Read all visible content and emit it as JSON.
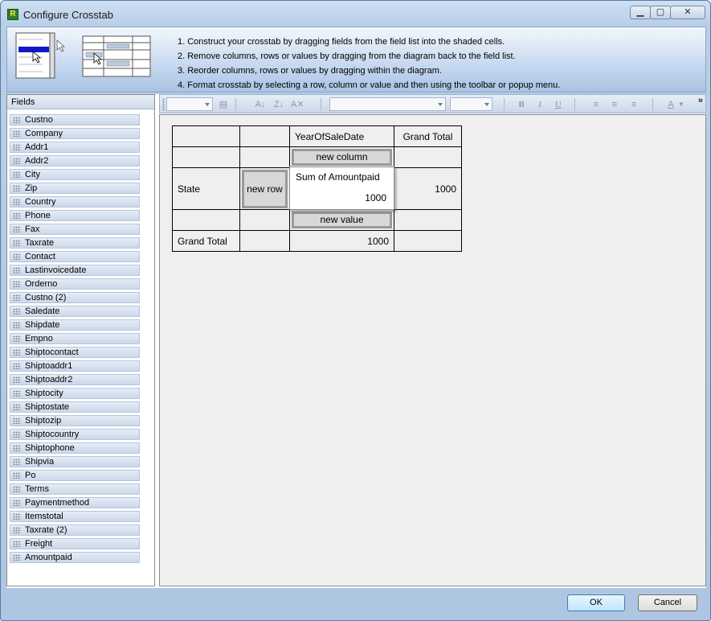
{
  "window": {
    "title": "Configure Crosstab",
    "app_icon_letter": "R"
  },
  "instructions": [
    "1. Construct your crosstab by dragging fields from the field list into the shaded cells.",
    "2. Remove columns, rows or values by dragging from the diagram back to the field list.",
    "3. Reorder columns, rows or values by dragging within the diagram.",
    "4. Format crosstab by selecting a row, column or value and then using the toolbar or popup menu."
  ],
  "fields_panel": {
    "header": "Fields",
    "items": [
      "Custno",
      "Company",
      "Addr1",
      "Addr2",
      "City",
      "Zip",
      "Country",
      "Phone",
      "Fax",
      "Taxrate",
      "Contact",
      "Lastinvoicedate",
      "Orderno",
      "Custno (2)",
      "Saledate",
      "Shipdate",
      "Empno",
      "Shiptocontact",
      "Shiptoaddr1",
      "Shiptoaddr2",
      "Shiptocity",
      "Shiptostate",
      "Shiptozip",
      "Shiptocountry",
      "Shiptophone",
      "Shipvia",
      "Po",
      "Terms",
      "Paymentmethod",
      "Itemstotal",
      "Taxrate (2)",
      "Freight",
      "Amountpaid"
    ]
  },
  "toolbar": {
    "icons": [
      "sort-ascending-icon",
      "sort-descending-icon",
      "clear-sort-icon",
      "bold-icon",
      "italic-icon",
      "underline-icon",
      "align-left-icon",
      "align-center-icon",
      "align-right-icon",
      "font-color-icon"
    ],
    "overflow": "»"
  },
  "crosstab": {
    "column_field": "YearOfSaleDate",
    "grand_total_header": "Grand Total",
    "new_column": "new column",
    "row_field": "State",
    "new_row": "new row",
    "value_label": "Sum of Amountpaid",
    "value": "1000",
    "row_grand_total": "1000",
    "new_value": "new value",
    "grand_total_row_label": "Grand Total",
    "column_grand_total": "1000"
  },
  "buttons": {
    "ok": "OK",
    "cancel": "Cancel"
  }
}
